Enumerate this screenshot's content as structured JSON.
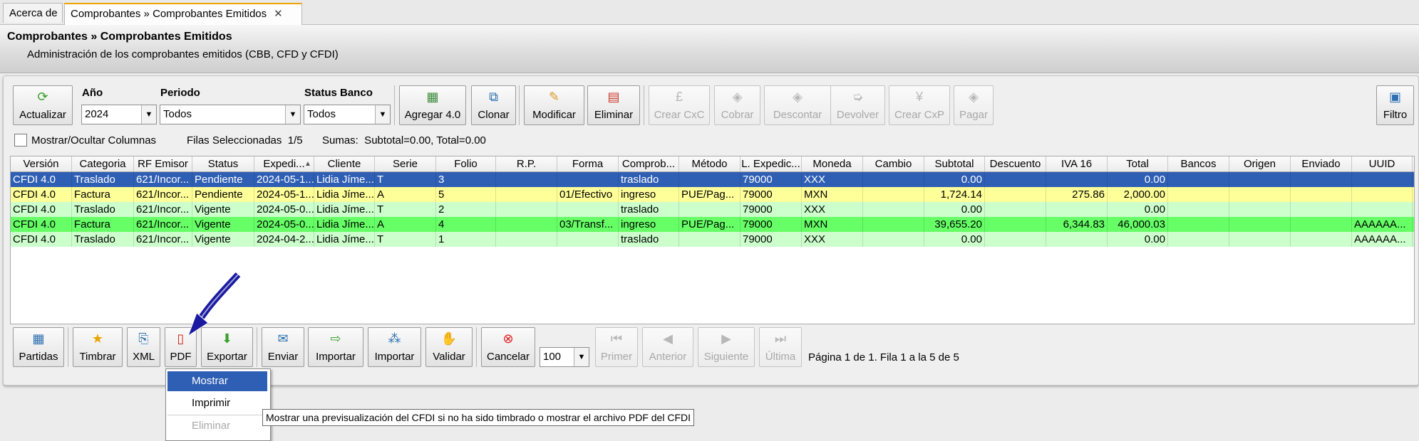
{
  "tabs": [
    {
      "label": "Acerca de"
    },
    {
      "label": "Comprobantes » Comprobantes Emitidos",
      "close": "✕"
    }
  ],
  "header": {
    "title": "Comprobantes » Comprobantes Emitidos",
    "subtitle": "Administración de los comprobantes emitidos (CBB, CFD y CFDI)"
  },
  "toolbar": {
    "refresh": "Actualizar",
    "year_label": "Año",
    "year_value": "2024",
    "period_label": "Periodo",
    "period_value": "Todos",
    "bank_label": "Status Banco",
    "bank_value": "Todos",
    "add": "Agregar 4.0",
    "clone": "Clonar",
    "modify": "Modificar",
    "delete": "Eliminar",
    "create_cxc": "Crear CxC",
    "charge": "Cobrar",
    "discount": "Descontar",
    "return": "Devolver",
    "create_cxp": "Crear CxP",
    "pay": "Pagar",
    "filter": "Filtro"
  },
  "options": {
    "toggle_columns": "Mostrar/Ocultar Columnas",
    "selected": "Filas Seleccionadas  1/5",
    "sums": "Sumas:  Subtotal=0.00, Total=0.00"
  },
  "table": {
    "columns": [
      "Versión",
      "Categoria",
      "RF Emisor",
      "Status",
      "Expedi...",
      "Cliente",
      "Serie",
      "Folio",
      "R.P.",
      "Forma",
      "Comprob...",
      "Método",
      "L. Expedic...",
      "Moneda",
      "Cambio",
      "Subtotal",
      "Descuento",
      "IVA 16",
      "Total",
      "Bancos",
      "Origen",
      "Enviado",
      "UUID"
    ],
    "sort_indicator": "▲",
    "rows": [
      [
        "CFDI 4.0",
        "Traslado",
        "621/Incor...",
        "Pendiente",
        "2024-05-1...",
        "Lidia Jíme...",
        "T",
        "3",
        "",
        "",
        "traslado",
        "",
        "79000",
        "XXX",
        "",
        "0.00",
        "",
        "",
        "0.00",
        "",
        "",
        "",
        ""
      ],
      [
        "CFDI 4.0",
        "Factura",
        "621/Incor...",
        "Pendiente",
        "2024-05-1...",
        "Lidia Jíme...",
        "A",
        "5",
        "",
        "01/Efectivo",
        "ingreso",
        "PUE/Pag...",
        "79000",
        "MXN",
        "",
        "1,724.14",
        "",
        "275.86",
        "2,000.00",
        "",
        "",
        "",
        ""
      ],
      [
        "CFDI 4.0",
        "Traslado",
        "621/Incor...",
        "Vigente",
        "2024-05-0...",
        "Lidia Jíme...",
        "T",
        "2",
        "",
        "",
        "traslado",
        "",
        "79000",
        "XXX",
        "",
        "0.00",
        "",
        "",
        "0.00",
        "",
        "",
        "",
        ""
      ],
      [
        "CFDI 4.0",
        "Factura",
        "621/Incor...",
        "Vigente",
        "2024-05-0...",
        "Lidia Jíme...",
        "A",
        "4",
        "",
        "03/Transf...",
        "ingreso",
        "PUE/Pag...",
        "79000",
        "MXN",
        "",
        "39,655.20",
        "",
        "6,344.83",
        "46,000.03",
        "",
        "",
        "",
        "AAAAAA..."
      ],
      [
        "CFDI 4.0",
        "Traslado",
        "621/Incor...",
        "Vigente",
        "2024-04-2...",
        "Lidia Jíme...",
        "T",
        "1",
        "",
        "",
        "traslado",
        "",
        "79000",
        "XXX",
        "",
        "0.00",
        "",
        "",
        "0.00",
        "",
        "",
        "",
        "AAAAAA..."
      ]
    ],
    "row_colors": [
      "#2f5fb4",
      "#ffff99",
      "#ccffcc",
      "#66ff66",
      "#ccffcc"
    ]
  },
  "bottom": {
    "items": "Partidas",
    "stamp": "Timbrar",
    "xml": "XML",
    "pdf": "PDF",
    "export": "Exportar",
    "send": "Enviar",
    "import1": "Importar",
    "import2": "Importar",
    "validate": "Validar",
    "cancel": "Cancelar",
    "page_size": "100",
    "first": "Primer",
    "prev": "Anterior",
    "next": "Siguiente",
    "last": "Última",
    "page_info": "Página 1 de 1. Fila 1 a la 5 de 5"
  },
  "pdf_menu": {
    "show": "Mostrar",
    "print": "Imprimir",
    "delete": "Eliminar"
  },
  "tooltip": "Mostrar una previsualización del CFDI si no ha sido timbrado o mostrar el archivo PDF del CFDI"
}
